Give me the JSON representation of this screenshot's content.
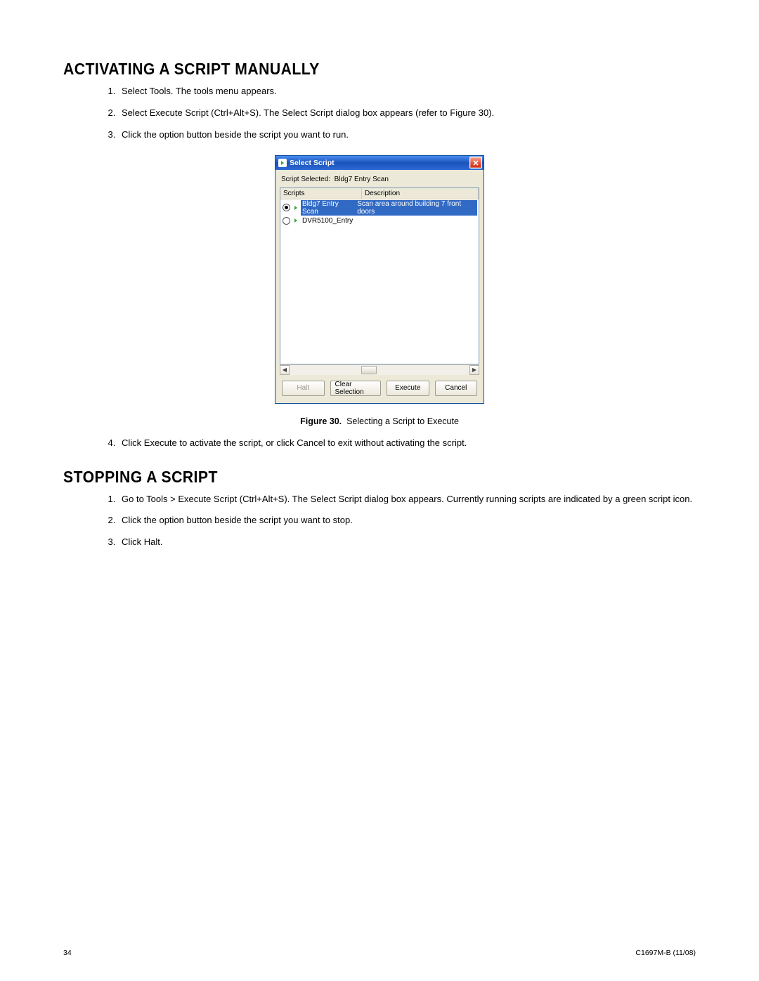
{
  "section1": {
    "heading": "ACTIVATING A SCRIPT MANUALLY",
    "steps": [
      "Select Tools. The tools menu appears.",
      "Select Execute Script (Ctrl+Alt+S). The Select Script dialog box appears (refer to Figure 30).",
      "Click the option button beside the script you want to run."
    ],
    "step4": "Click Execute to activate the script, or click Cancel to exit without activating the script."
  },
  "dialog": {
    "title": "Select Script",
    "selected_label": "Script Selected:",
    "selected_value": "Bldg7 Entry Scan",
    "columns": {
      "scripts": "Scripts",
      "description": "Description"
    },
    "rows": [
      {
        "name": "Bldg7 Entry Scan",
        "desc": "Scan area around building 7 front doors",
        "checked": true
      },
      {
        "name": "DVR5100_Entry",
        "desc": "",
        "checked": false
      }
    ],
    "buttons": {
      "halt": "Halt",
      "clear": "Clear Selection",
      "execute": "Execute",
      "cancel": "Cancel"
    }
  },
  "figure": {
    "label": "Figure 30.",
    "caption": "Selecting a Script to Execute"
  },
  "section2": {
    "heading": "STOPPING A SCRIPT",
    "steps": [
      "Go to Tools > Execute Script (Ctrl+Alt+S). The Select Script dialog box appears. Currently running scripts are indicated by a green script icon.",
      "Click the option button beside the script you want to stop.",
      "Click Halt."
    ]
  },
  "footer": {
    "page": "34",
    "doc": "C1697M-B (11/08)"
  }
}
